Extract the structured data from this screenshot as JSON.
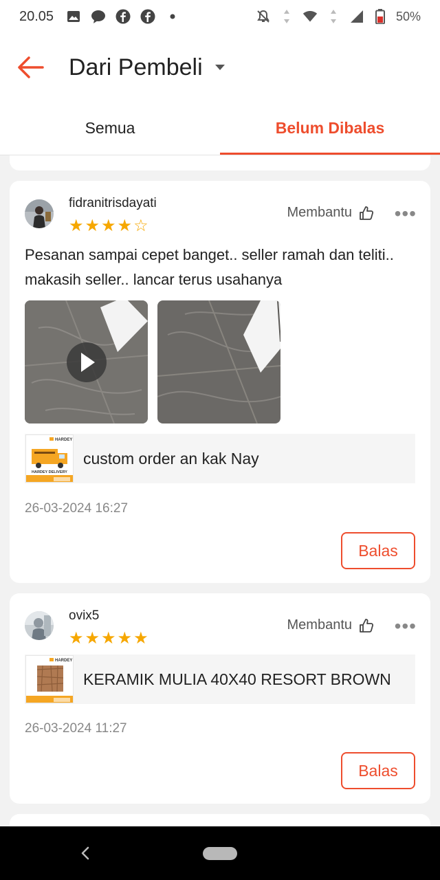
{
  "status_bar": {
    "time": "20.05",
    "battery": "50%"
  },
  "header": {
    "title": "Dari Pembeli"
  },
  "tabs": [
    {
      "label": "Semua",
      "active": false
    },
    {
      "label": "Belum Dibalas",
      "active": true
    }
  ],
  "accent_color": "#ee4d2d",
  "star_color": "#f6a700",
  "reviews": [
    {
      "username": "fidranitrisdayati",
      "rating": 4,
      "helpful_label": "Membantu",
      "comment": "Pesanan sampai cepet banget.. seller ramah dan teliti.. makasih seller.. lancar terus usahanya",
      "media": [
        {
          "type": "video"
        },
        {
          "type": "photo"
        }
      ],
      "product": {
        "name": "custom order an kak Nay",
        "thumb_brand": "HARDEY",
        "thumb_caption": "HARDEY DELIVERY"
      },
      "date": "26-03-2024 16:27",
      "reply_label": "Balas"
    },
    {
      "username": "ovix5",
      "rating": 5,
      "helpful_label": "Membantu",
      "comment": "",
      "media": [],
      "product": {
        "name": "KERAMIK MULIA 40X40 RESORT BROWN",
        "thumb_brand": "HARDEY"
      },
      "date": "26-03-2024 11:27",
      "reply_label": "Balas"
    }
  ]
}
